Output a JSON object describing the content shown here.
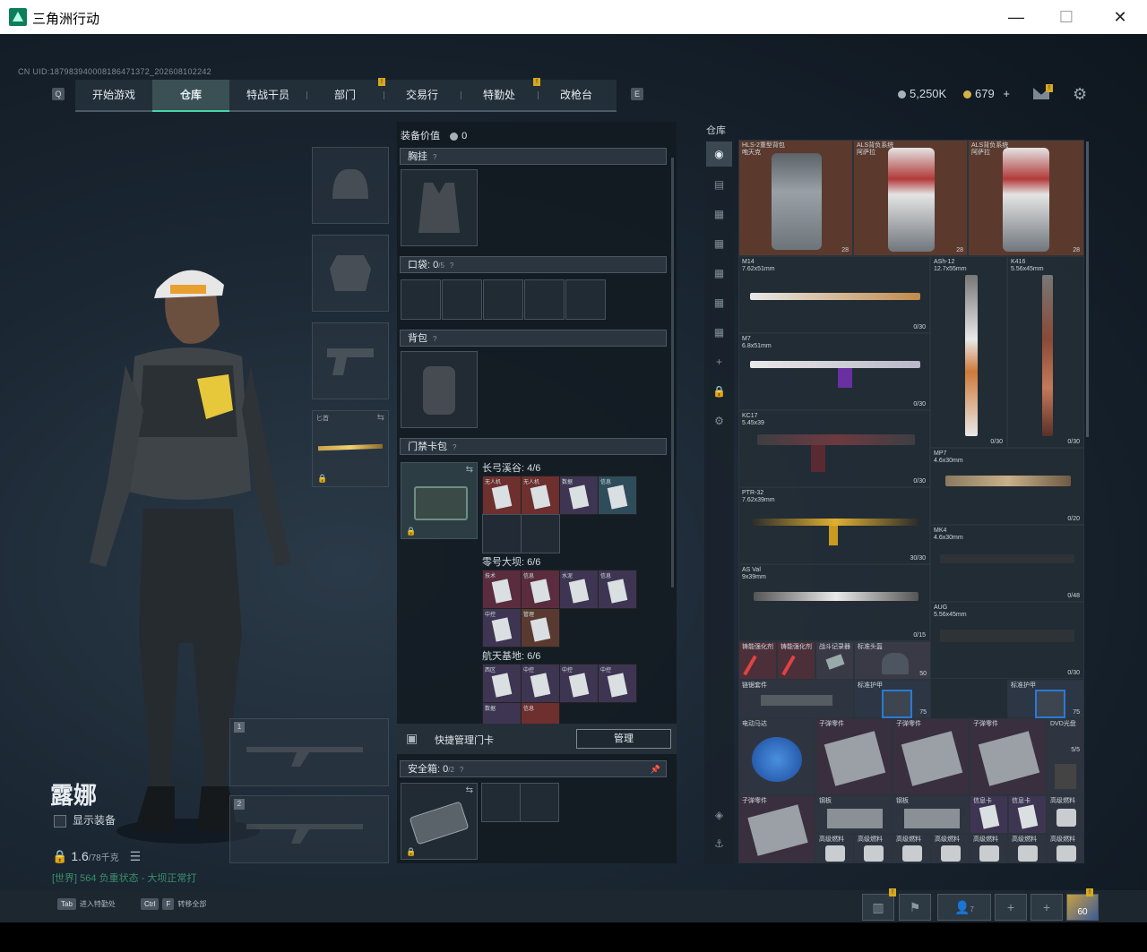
{
  "window": {
    "title": "三角洲行动",
    "minimize": "—",
    "maximize": "☐",
    "close": "✕"
  },
  "header": {
    "uid": "CN UID:187983940008186471372_202608102242",
    "key_left": "Q",
    "key_right": "E",
    "tabs": [
      {
        "label": "开始游戏"
      },
      {
        "label": "仓库"
      },
      {
        "label": "特战干员"
      },
      {
        "label": "部门"
      },
      {
        "label": "交易行"
      },
      {
        "label": "特勤处"
      },
      {
        "label": "改枪台"
      }
    ],
    "currency1": "5,250K",
    "currency2": "679",
    "currency2_add": "+",
    "badge": "!"
  },
  "character": {
    "name": "露娜",
    "show_equipment": "显示装备",
    "weight": "1.6",
    "weight_max": "/78千克",
    "status": "[世界] 564 负重状态 - 大坝正常打",
    "melee_label": "匕首"
  },
  "loadout": {
    "value_label": "装备价值",
    "value": "0",
    "chest": "胸挂",
    "pocket": "口袋:",
    "pocket_count": "0",
    "pocket_max": "/5",
    "backpack": "背包",
    "keycard": "门禁卡包",
    "q": "?",
    "maps": [
      {
        "name": "长弓溪谷: 4/6",
        "cards": [
          "无人机",
          "无人机",
          "数据",
          "信息"
        ]
      },
      {
        "name": "零号大坝: 6/6",
        "cards": [
          "技术",
          "信息",
          "水泥",
          "信息",
          "中控",
          "管理"
        ]
      },
      {
        "name": "航天基地: 6/6",
        "cards": [
          "西区",
          "中控",
          "中控",
          "中控",
          "数据",
          "信息"
        ]
      }
    ],
    "quick_manage": "快捷管理门卡",
    "manage_btn": "管理",
    "safebox": "安全箱:",
    "safebox_count": "0",
    "safebox_max": "/2"
  },
  "stash": {
    "title": "仓库",
    "backpacks": [
      {
        "name": "HLS-2重型背包",
        "sub": "咆天克",
        "count": "28"
      },
      {
        "name": "ALS背负系统",
        "sub": "阿萨拉",
        "count": "28"
      },
      {
        "name": "ALS背负系统",
        "sub": "阿萨拉",
        "count": "28"
      }
    ],
    "guns": [
      {
        "name": "M14",
        "cal": "7.62x51mm",
        "ammo": "0/30"
      },
      {
        "name": "ASh-12",
        "cal": "12.7x55mm",
        "ammo": "0/30"
      },
      {
        "name": "K416",
        "cal": "5.56x45mm",
        "ammo": "0/30"
      },
      {
        "name": "M7",
        "cal": "6.8x51mm",
        "ammo": "0/30"
      },
      {
        "name": "KC17",
        "cal": "5.45x39",
        "ammo": "0/30"
      },
      {
        "name": "MP7",
        "cal": "4.6x30mm",
        "ammo": "0/20"
      },
      {
        "name": "PTR-32",
        "cal": "7.62x39mm",
        "ammo": "30/30"
      },
      {
        "name": "MK4",
        "cal": "4.6x30mm",
        "ammo": "0/48"
      },
      {
        "name": "AS Val",
        "cal": "9x39mm",
        "ammo": "0/15"
      },
      {
        "name": "AUG",
        "cal": "5.56x45mm",
        "ammo": "0/30"
      }
    ],
    "misc": [
      {
        "name": "铸能强化剂"
      },
      {
        "name": "铸能强化剂"
      },
      {
        "name": "战斗记录器"
      },
      {
        "name": "标准头盔"
      },
      {
        "name": "链锯套件"
      },
      {
        "name": "标准护甲"
      },
      {
        "name": "标准护甲"
      },
      {
        "name": "电动马达"
      },
      {
        "name": "子弹零件"
      },
      {
        "name": "子弹零件"
      },
      {
        "name": "子弹零件"
      },
      {
        "name": "DVD光盘"
      },
      {
        "name": "子弹零件"
      },
      {
        "name": "钢板"
      },
      {
        "name": "钢板"
      },
      {
        "name": "信息卡"
      },
      {
        "name": "信息卡"
      },
      {
        "name": "高级燃料"
      },
      {
        "name": "高级燃料"
      },
      {
        "name": "高级燃料"
      },
      {
        "name": "高级燃料"
      },
      {
        "name": "高级燃料"
      },
      {
        "name": "高级燃料"
      },
      {
        "name": "高级燃料"
      },
      {
        "name": "高级燃料"
      }
    ],
    "misc_counts": {
      "helmet": "50",
      "armor1": "75",
      "armor2": "75",
      "dvd": "5/5"
    }
  },
  "bottom": {
    "tab_key": "Tab",
    "tab_label": "进入特勤处",
    "ctrl_key": "Ctrl",
    "f_key": "F",
    "ctrl_label": "转移全部",
    "friends_count": "7",
    "level": "60"
  },
  "colors": {
    "accent": "#46d6a5",
    "badge": "#d6a820",
    "panel": "#121a21"
  }
}
